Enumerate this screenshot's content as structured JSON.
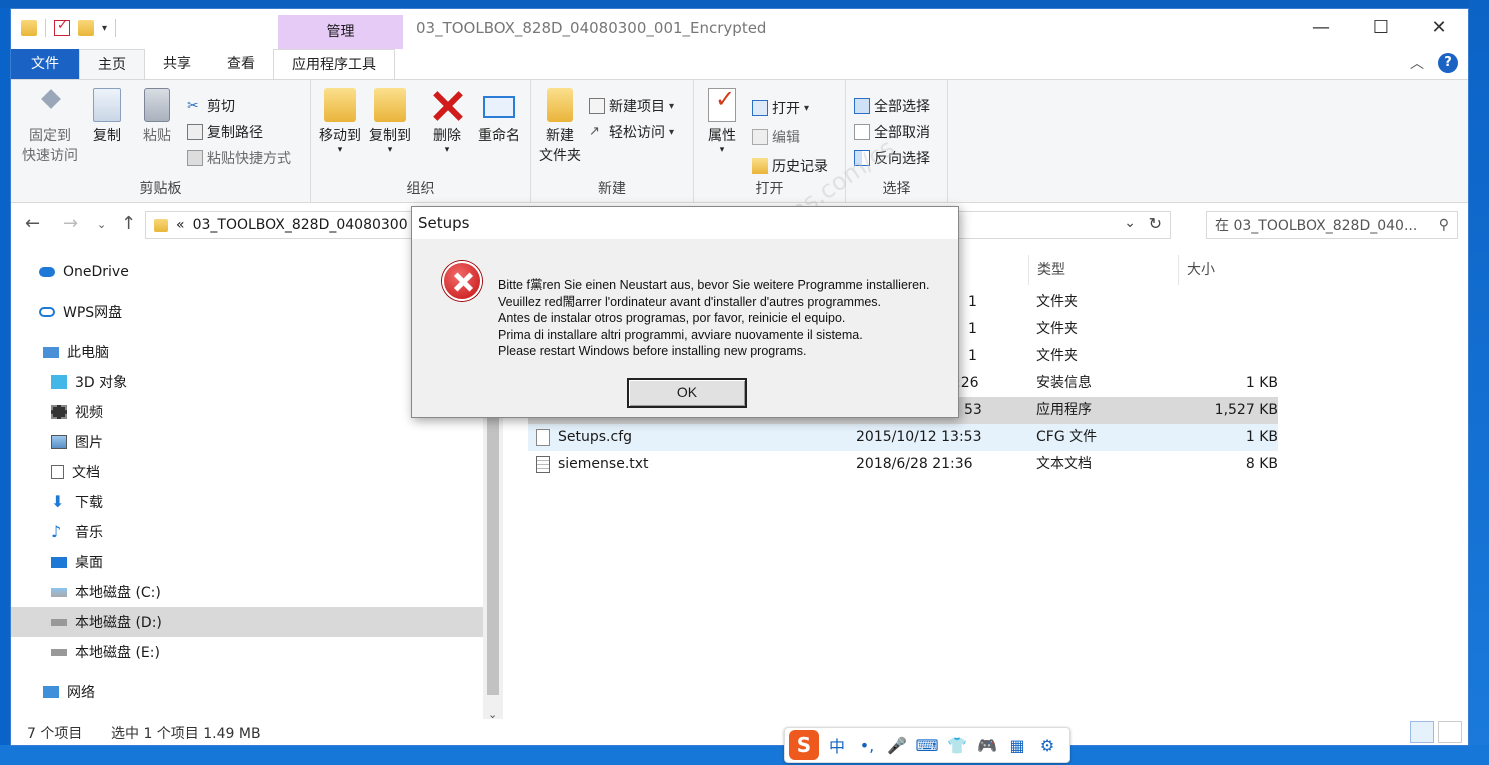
{
  "window": {
    "title": "03_TOOLBOX_828D_04080300_001_Encrypted",
    "manage_tab": "管理",
    "controls": {
      "minimize": "—",
      "maximize": "☐",
      "close": "✕"
    }
  },
  "tabs": [
    "文件",
    "主页",
    "共享",
    "查看",
    "应用程序工具"
  ],
  "ribbon": {
    "clipboard": {
      "label": "剪贴板",
      "pin": "固定到\n快速访问",
      "pin_l1": "固定到",
      "pin_l2": "快速访问",
      "copy": "复制",
      "paste": "粘贴",
      "cut": "剪切",
      "copy_path": "复制路径",
      "paste_shortcut": "粘贴快捷方式"
    },
    "organize": {
      "label": "组织",
      "move_to": "移动到",
      "copy_to": "复制到",
      "delete": "删除",
      "rename": "重命名"
    },
    "new": {
      "label": "新建",
      "new_folder_l1": "新建",
      "new_folder_l2": "文件夹",
      "new_item": "新建项目",
      "easy_access": "轻松访问"
    },
    "open": {
      "label": "打开",
      "properties": "属性",
      "open": "打开",
      "edit": "编辑",
      "history": "历史记录"
    },
    "select": {
      "label": "选择",
      "select_all": "全部选择",
      "select_none": "全部取消",
      "invert": "反向选择"
    }
  },
  "address": {
    "path": "03_TOOLBOX_828D_04080300",
    "prefix": "«",
    "search_placeholder": "在 03_TOOLBOX_828D_040..."
  },
  "nav": [
    {
      "label": "OneDrive"
    },
    {
      "label": "WPS网盘"
    },
    {
      "label": "此电脑"
    },
    {
      "label": "3D 对象"
    },
    {
      "label": "视频"
    },
    {
      "label": "图片"
    },
    {
      "label": "文档"
    },
    {
      "label": "下载"
    },
    {
      "label": "音乐"
    },
    {
      "label": "桌面"
    },
    {
      "label": "本地磁盘 (C:)"
    },
    {
      "label": "本地磁盘 (D:)"
    },
    {
      "label": "本地磁盘 (E:)"
    },
    {
      "label": "网络"
    }
  ],
  "columns": {
    "type": "类型",
    "size": "大小"
  },
  "files": [
    {
      "name": "",
      "date": "1",
      "type": "文件夹",
      "size": ""
    },
    {
      "name": "",
      "date": "1",
      "type": "文件夹",
      "size": ""
    },
    {
      "name": "",
      "date": "1",
      "type": "文件夹",
      "size": ""
    },
    {
      "name": "",
      "date": ":26",
      "type": "安装信息",
      "size": "1 KB"
    },
    {
      "name": "",
      "date": "53",
      "type": "应用程序",
      "size": "1,527 KB"
    },
    {
      "name": "Setups.cfg",
      "date": "2015/10/12 13:53",
      "type": "CFG 文件",
      "size": "1 KB"
    },
    {
      "name": "siemense.txt",
      "date": "2018/6/28 21:36",
      "type": "文本文档",
      "size": "8 KB"
    }
  ],
  "status": {
    "count": "7 个项目",
    "selected": "选中 1 个项目  1.49 MB"
  },
  "dialog": {
    "title": "Setups",
    "lines": [
      "Bitte f黨ren Sie einen Neustart aus, bevor Sie weitere Programme installieren.",
      "Veuillez red閙arrer l'ordinateur avant d'installer d'autres programmes.",
      "Antes de instalar otros programas, por favor, reinicie el equipo.",
      "Prima di installare altri programmi, avviare nuovamente il sistema.",
      "Please restart Windows before installing new programs."
    ],
    "ok": "OK"
  },
  "watermark": "support.industry.siemens.com/cs",
  "ime": {
    "logo": "S",
    "items": [
      "中",
      "•,",
      "🎤",
      "⌨",
      "👕",
      "🎮",
      "▦",
      "⚙"
    ]
  }
}
